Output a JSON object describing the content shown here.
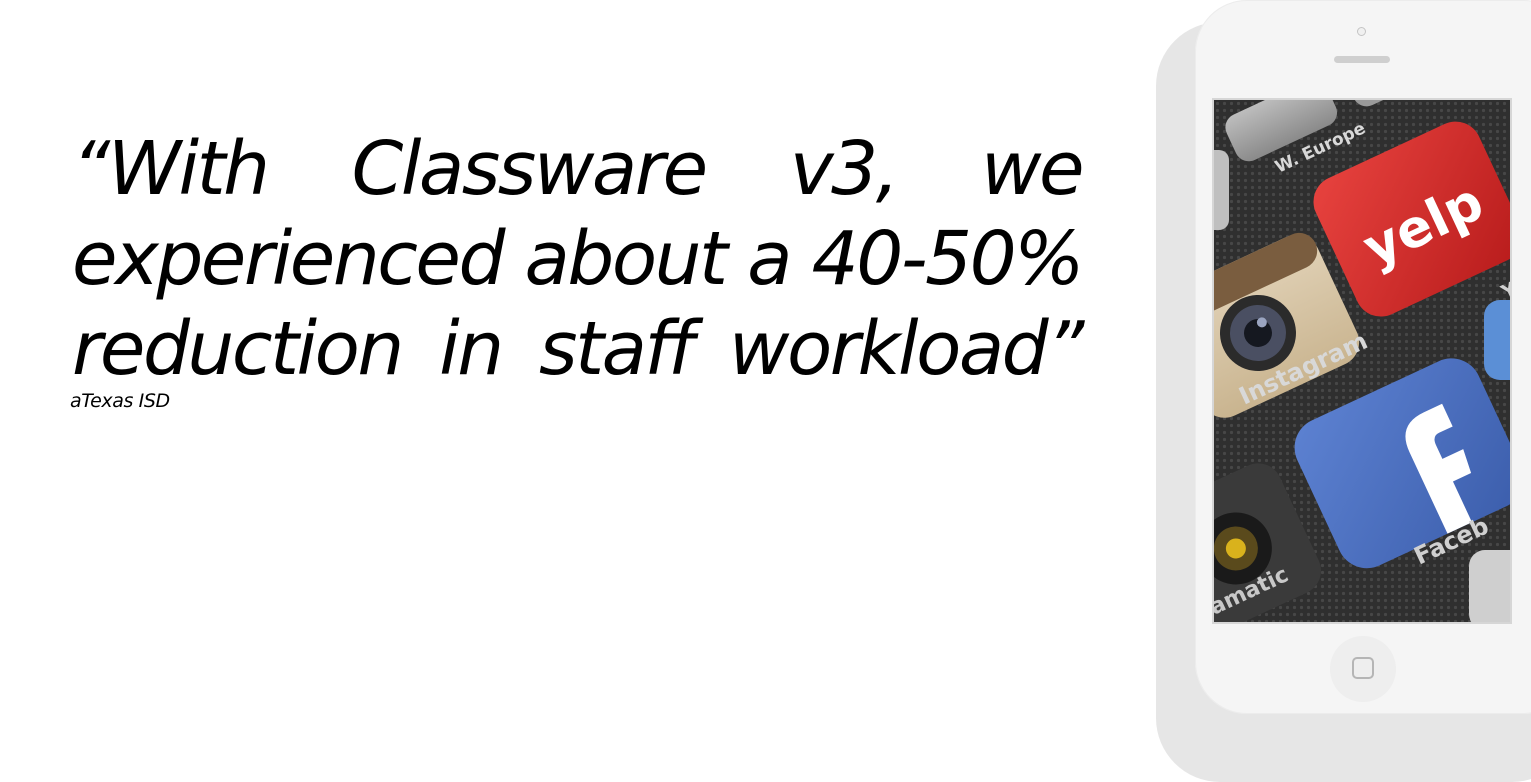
{
  "quote": {
    "text": "“With Classware v3, we experienced about a 40-50% reduction in staff workload”",
    "attribution": "aTexas ISD"
  },
  "phone": {
    "screen_image": "app-icons-photo",
    "app_labels": {
      "europe": "W. Europe",
      "yelp": "yelp",
      "yelp_label": "Yel",
      "instagram": "Instagram",
      "facebook_label": "Faceb",
      "other_label": "amatic"
    },
    "colors": {
      "yelp_red": "#d32323",
      "facebook_blue": "#3b5998",
      "instagram_beige": "#d9c7a8",
      "screen_dark": "#2b2b2b"
    }
  }
}
